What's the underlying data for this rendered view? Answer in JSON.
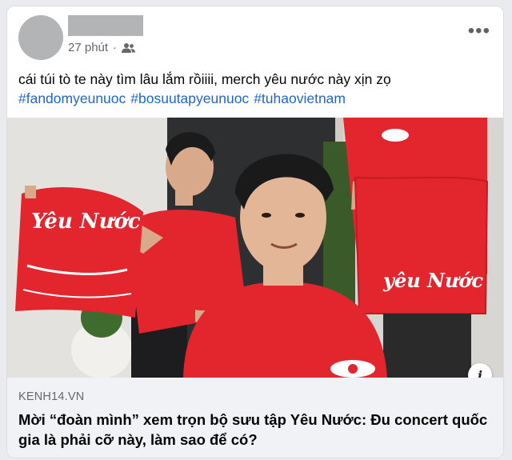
{
  "post": {
    "time": "27 phút",
    "separator": "·",
    "audience_icon": "friends-icon",
    "more_icon": "more-options-icon",
    "caption": "cái túi tò te này tìm lâu lắm rồiiii, merch yêu nước này xịn zọ",
    "hashtags": [
      "#fandomyeunuoc",
      "#bosuutapyeunuoc",
      "#tuhaovietnam"
    ]
  },
  "media": {
    "bag_text_left": "Yêu Nước",
    "bag_text_right": "yêu Nước",
    "info_label": "i"
  },
  "link": {
    "source": "KENH14.VN",
    "title": "Mời “đoàn mình” xem trọn bộ sưu tập Yêu Nước: Đu concert quốc gia là phải cỡ này, làm sao để có?"
  },
  "colors": {
    "link_blue": "#1f66c9",
    "shirt_red": "#e3262e",
    "muted": "#65676b"
  }
}
